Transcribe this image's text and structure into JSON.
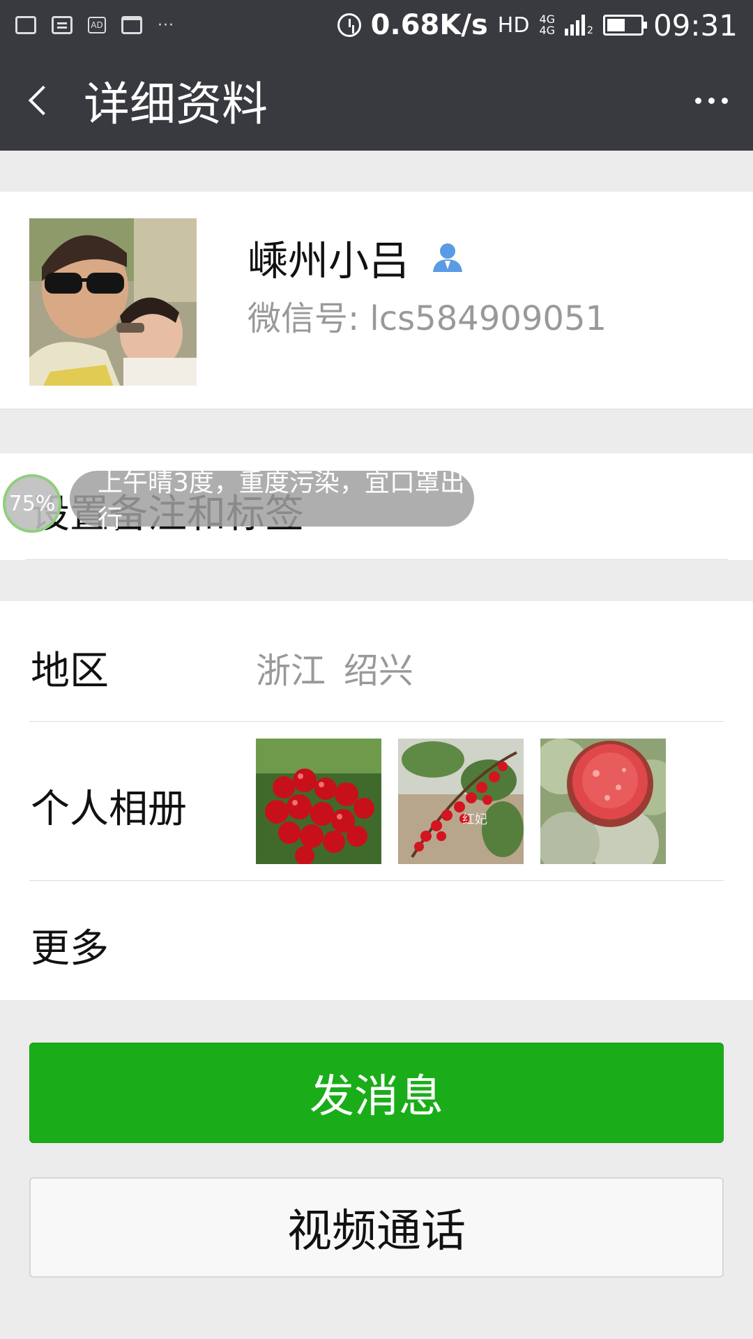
{
  "status_bar": {
    "ad_badge": "AD",
    "more_dots": "···",
    "network_speed": "0.68K/s",
    "hd_label": "HD",
    "net_type_1": "4G",
    "net_type_2": "4G",
    "sim_index": "2",
    "battery_level": 0.55,
    "time": "09:31"
  },
  "nav": {
    "title": "详细资料"
  },
  "profile": {
    "nickname": "嵊州小吕",
    "wechat_id": "微信号: lcs584909051",
    "gender_icon": "male-user-icon"
  },
  "remark": {
    "label": "设置备注和标签"
  },
  "weather_overlay": {
    "percent": "75%",
    "text": "上午晴3度，重度污染，宜口罩出行"
  },
  "info": {
    "region_label": "地区",
    "region_value": "浙江  绍兴",
    "album_label": "个人相册",
    "album_watermark": "红妃",
    "more_label": "更多"
  },
  "actions": {
    "message_button": "发消息",
    "video_call_button": "视频通话"
  },
  "colors": {
    "header": "#393a3f",
    "primary_green": "#1aad19",
    "background": "#ececec",
    "secondary_text": "#999999"
  }
}
